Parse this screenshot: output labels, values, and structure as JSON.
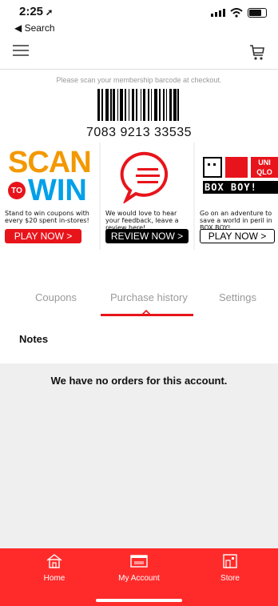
{
  "status": {
    "time": "2:25",
    "back_label": "◀ Search"
  },
  "header": {
    "menu_icon": "hamburger-icon",
    "cart_icon": "cart-icon"
  },
  "membership": {
    "instruction": "Please scan your membership barcode at checkout.",
    "code": "7083 9213 33535"
  },
  "promos": [
    {
      "id": "scan-to-win",
      "art_text": [
        "SCAN",
        "TO",
        "WIN"
      ],
      "description": "Stand to win coupons with every $20 spent in-stores!",
      "button": "PLAY NOW >"
    },
    {
      "id": "review",
      "description": "We would love to hear your feedback, leave a review here!",
      "button": "REVIEW NOW >"
    },
    {
      "id": "box-boy",
      "art_text": [
        "UNI",
        "QLO",
        "BOX BOY!"
      ],
      "description": "Go on an adventure to save a world in peril in BOX BOY!",
      "button": "PLAY NOW >"
    }
  ],
  "tabs": [
    {
      "label": "Coupons"
    },
    {
      "label": "Purchase history",
      "active": true
    },
    {
      "label": "Settings"
    }
  ],
  "notes": {
    "heading": "Notes",
    "empty_message": "We have no orders for this account."
  },
  "tabbar": [
    {
      "label": "Home",
      "icon": "home-icon"
    },
    {
      "label": "My Account",
      "icon": "membership-card-icon"
    },
    {
      "label": "Store",
      "icon": "store-icon"
    }
  ],
  "colors": {
    "brand_red": "#e8141b",
    "tabbar_red": "#ff2b2b",
    "scan_orange": "#f39800",
    "win_blue": "#00a0e9"
  }
}
